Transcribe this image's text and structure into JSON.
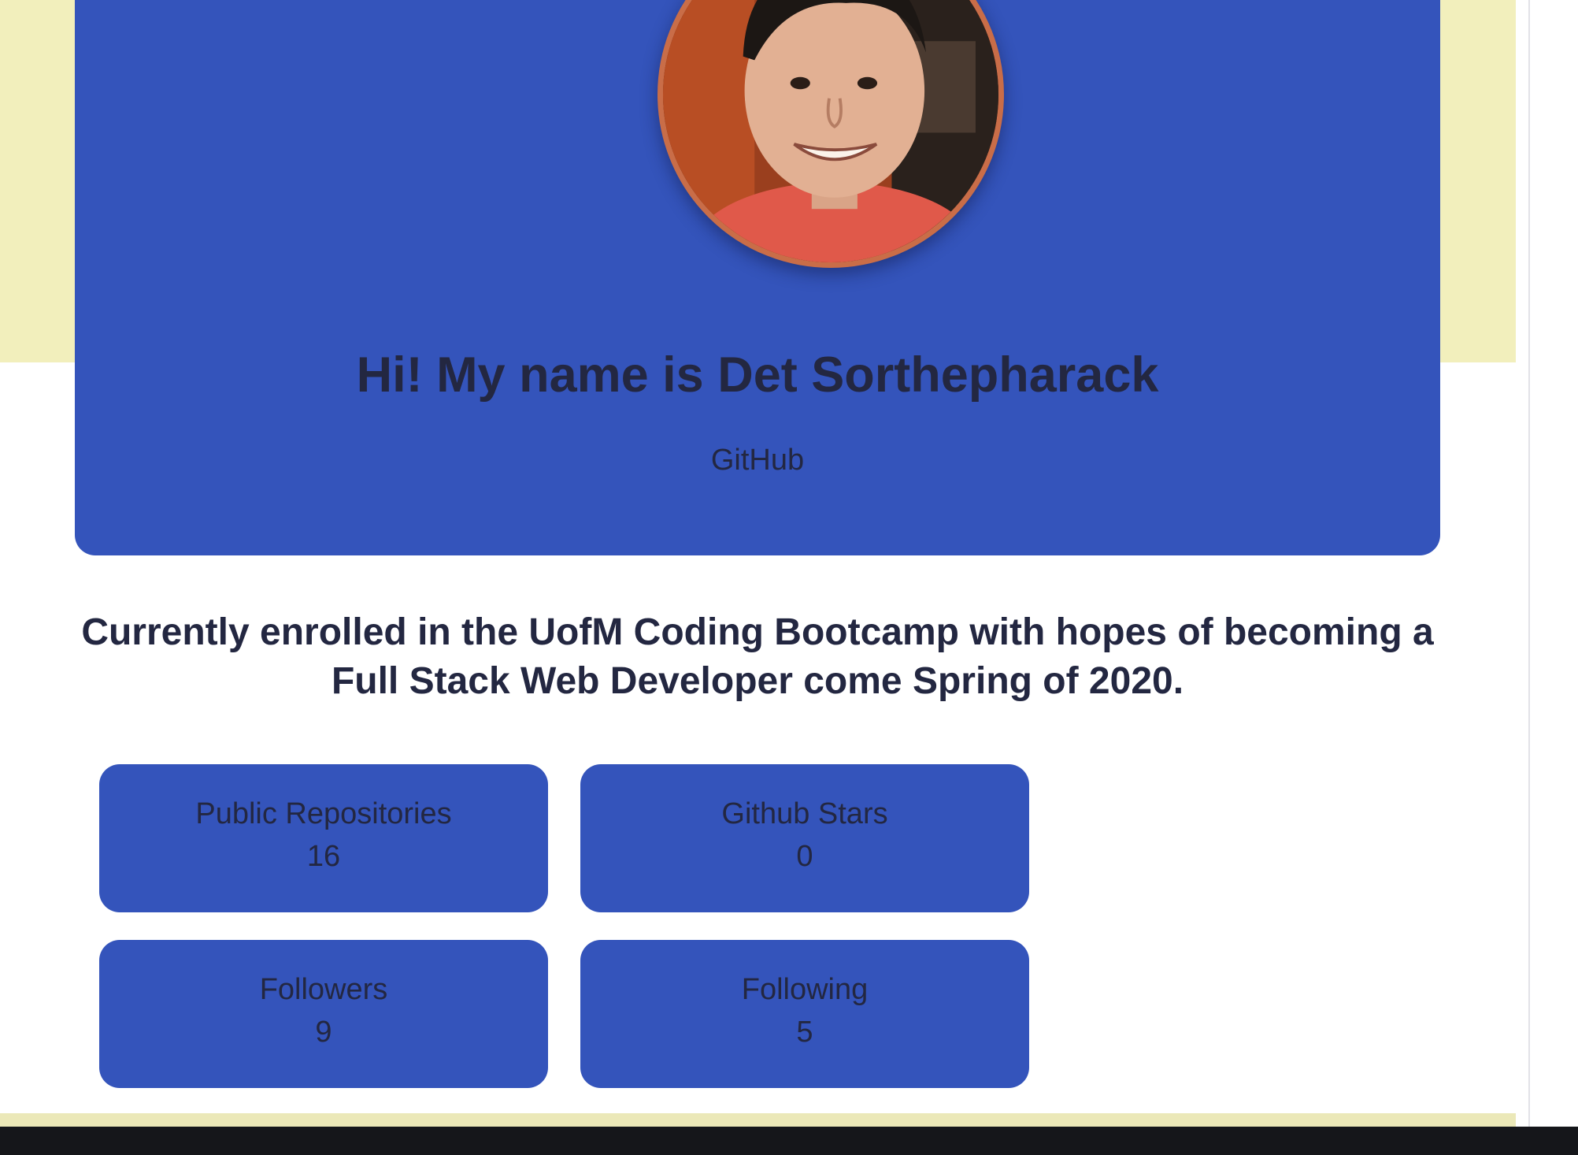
{
  "header": {
    "title": "Hi! My name is Det Sorthepharack",
    "github_link": "GitHub"
  },
  "bio": "Currently enrolled in the UofM Coding Bootcamp with hopes of becoming a Full Stack Web Developer come Spring of 2020.",
  "stats": [
    {
      "label": "Public Repositories",
      "value": "16"
    },
    {
      "label": "Github Stars",
      "value": "0"
    },
    {
      "label": "Followers",
      "value": "9"
    },
    {
      "label": "Following",
      "value": "5"
    }
  ],
  "colors": {
    "card_blue": "#3454bb",
    "band_yellow": "#f2efbc",
    "text_dark": "#232741",
    "avatar_border": "#c96d48"
  }
}
